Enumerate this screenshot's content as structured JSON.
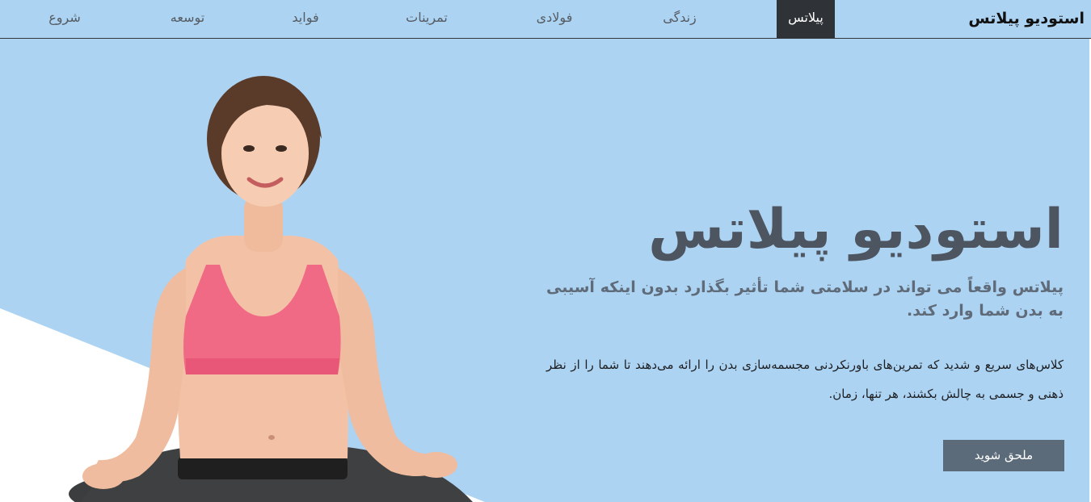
{
  "navbar": {
    "brand": "استودیو پیلاتس",
    "items": [
      {
        "label": "پیلاتس",
        "active": true
      },
      {
        "label": "زندگی",
        "active": false
      },
      {
        "label": "فولادی",
        "active": false
      },
      {
        "label": "تمرینات",
        "active": false
      },
      {
        "label": "فواید",
        "active": false
      },
      {
        "label": "توسعه",
        "active": false
      },
      {
        "label": "شروع",
        "active": false
      }
    ]
  },
  "hero": {
    "title": "استودیو پیلاتس",
    "subtitle": "پیلاتس واقعاً می تواند در سلامتی شما تأثیر بگذارد بدون اینکه آسیبی به بدن شما وارد کند.",
    "description": "کلاس‌های سریع و شدید که تمرین‌های باورنکردنی مجسمه‌سازی بدن را ارائه می‌دهند تا شما را از نظر ذهنی و جسمی به چالش بکشند، هر تنها، زمان.",
    "cta_label": "ملحق شوید",
    "image": "woman-meditating-yoga-pose"
  },
  "colors": {
    "background": "#add3f3",
    "nav_active": "#2f3237",
    "button": "#5c6b7a",
    "title": "#4d5660"
  }
}
